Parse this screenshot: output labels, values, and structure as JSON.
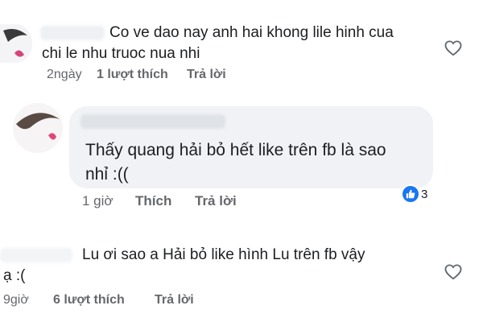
{
  "comments": [
    {
      "text": "Co ve dao nay anh hai khong lile hinh cua\nchi le nhu truoc nua nhi",
      "time": "2ngày",
      "likes": "1 lượt thích",
      "reply": "Trả lời",
      "icon": "heart-outline-icon"
    },
    {
      "text": "Thấy quang hải bỏ hết like trên fb là sao\nnhỉ :((",
      "time": "1 giờ",
      "like_label": "Thích",
      "reply": "Trả lời",
      "reaction_count": "3",
      "reaction_icon": "like-thumb-icon"
    },
    {
      "text": "Lu ơi sao a Hải bỏ like hình Lu trên fb vậy\nạ :(",
      "time": "9giờ",
      "likes": "6 lượt thích",
      "reply": "Trả lời",
      "icon": "heart-outline-icon"
    }
  ],
  "colors": {
    "accent": "#1877f2",
    "bubble": "#f0f2f5",
    "meta": "#65676b"
  }
}
